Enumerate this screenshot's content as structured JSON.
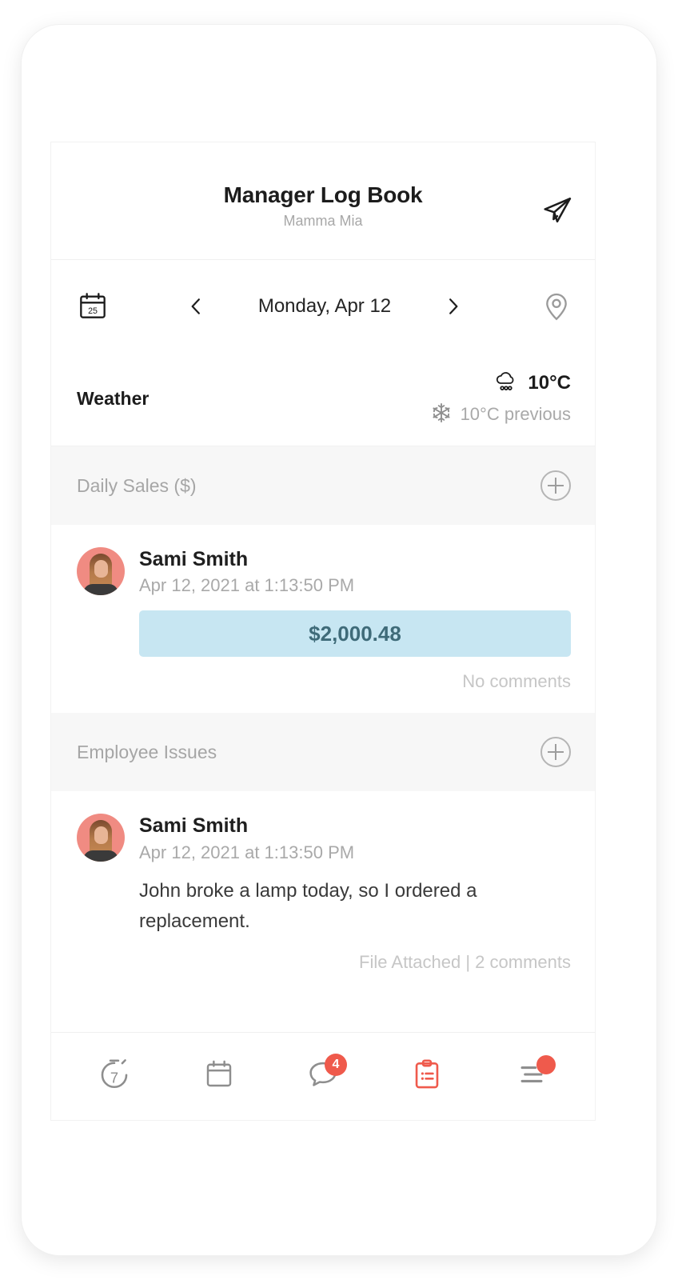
{
  "header": {
    "title": "Manager Log Book",
    "subtitle": "Mamma Mia",
    "send_icon": "send-paper-plane-icon"
  },
  "date_bar": {
    "calendar_icon": "calendar-icon",
    "calendar_day": "25",
    "prev_icon": "chevron-left-icon",
    "date_label": "Monday, Apr 12",
    "next_icon": "chevron-right-icon",
    "location_icon": "location-pin-icon"
  },
  "weather": {
    "label": "Weather",
    "current_icon": "rain-cloud-icon",
    "current_temp": "10°C",
    "previous_icon": "snowflake-icon",
    "previous_temp": "10°C previous"
  },
  "sections": [
    {
      "title": "Daily Sales ($)",
      "add_icon": "plus-circle-icon",
      "entries": [
        {
          "author": "Sami Smith",
          "timestamp": "Apr 12, 2021 at 1:13:50 PM",
          "amount": "$2,000.48",
          "footer": "No comments",
          "avatar": "avatar"
        }
      ]
    },
    {
      "title": "Employee Issues",
      "add_icon": "plus-circle-icon",
      "entries": [
        {
          "author": "Sami Smith",
          "timestamp": "Apr 12, 2021 at 1:13:50 PM",
          "body": "John broke a lamp today, so I ordered a replacement.",
          "footer": "File Attached | 2 comments",
          "avatar": "avatar"
        }
      ]
    }
  ],
  "bottom_nav": [
    {
      "icon": "stopwatch-seven-icon",
      "badge": ""
    },
    {
      "icon": "calendar-icon",
      "badge": ""
    },
    {
      "icon": "chat-bubble-icon",
      "badge": "4"
    },
    {
      "icon": "clipboard-icon",
      "badge": ""
    },
    {
      "icon": "menu-list-icon",
      "badge": "•"
    }
  ],
  "colors": {
    "accent_red": "#ef5a4c",
    "amount_pill_bg": "#c7e6f2",
    "amount_text": "#3f6b79",
    "section_bg": "#f7f7f7",
    "muted_text": "#a9a9a9"
  }
}
